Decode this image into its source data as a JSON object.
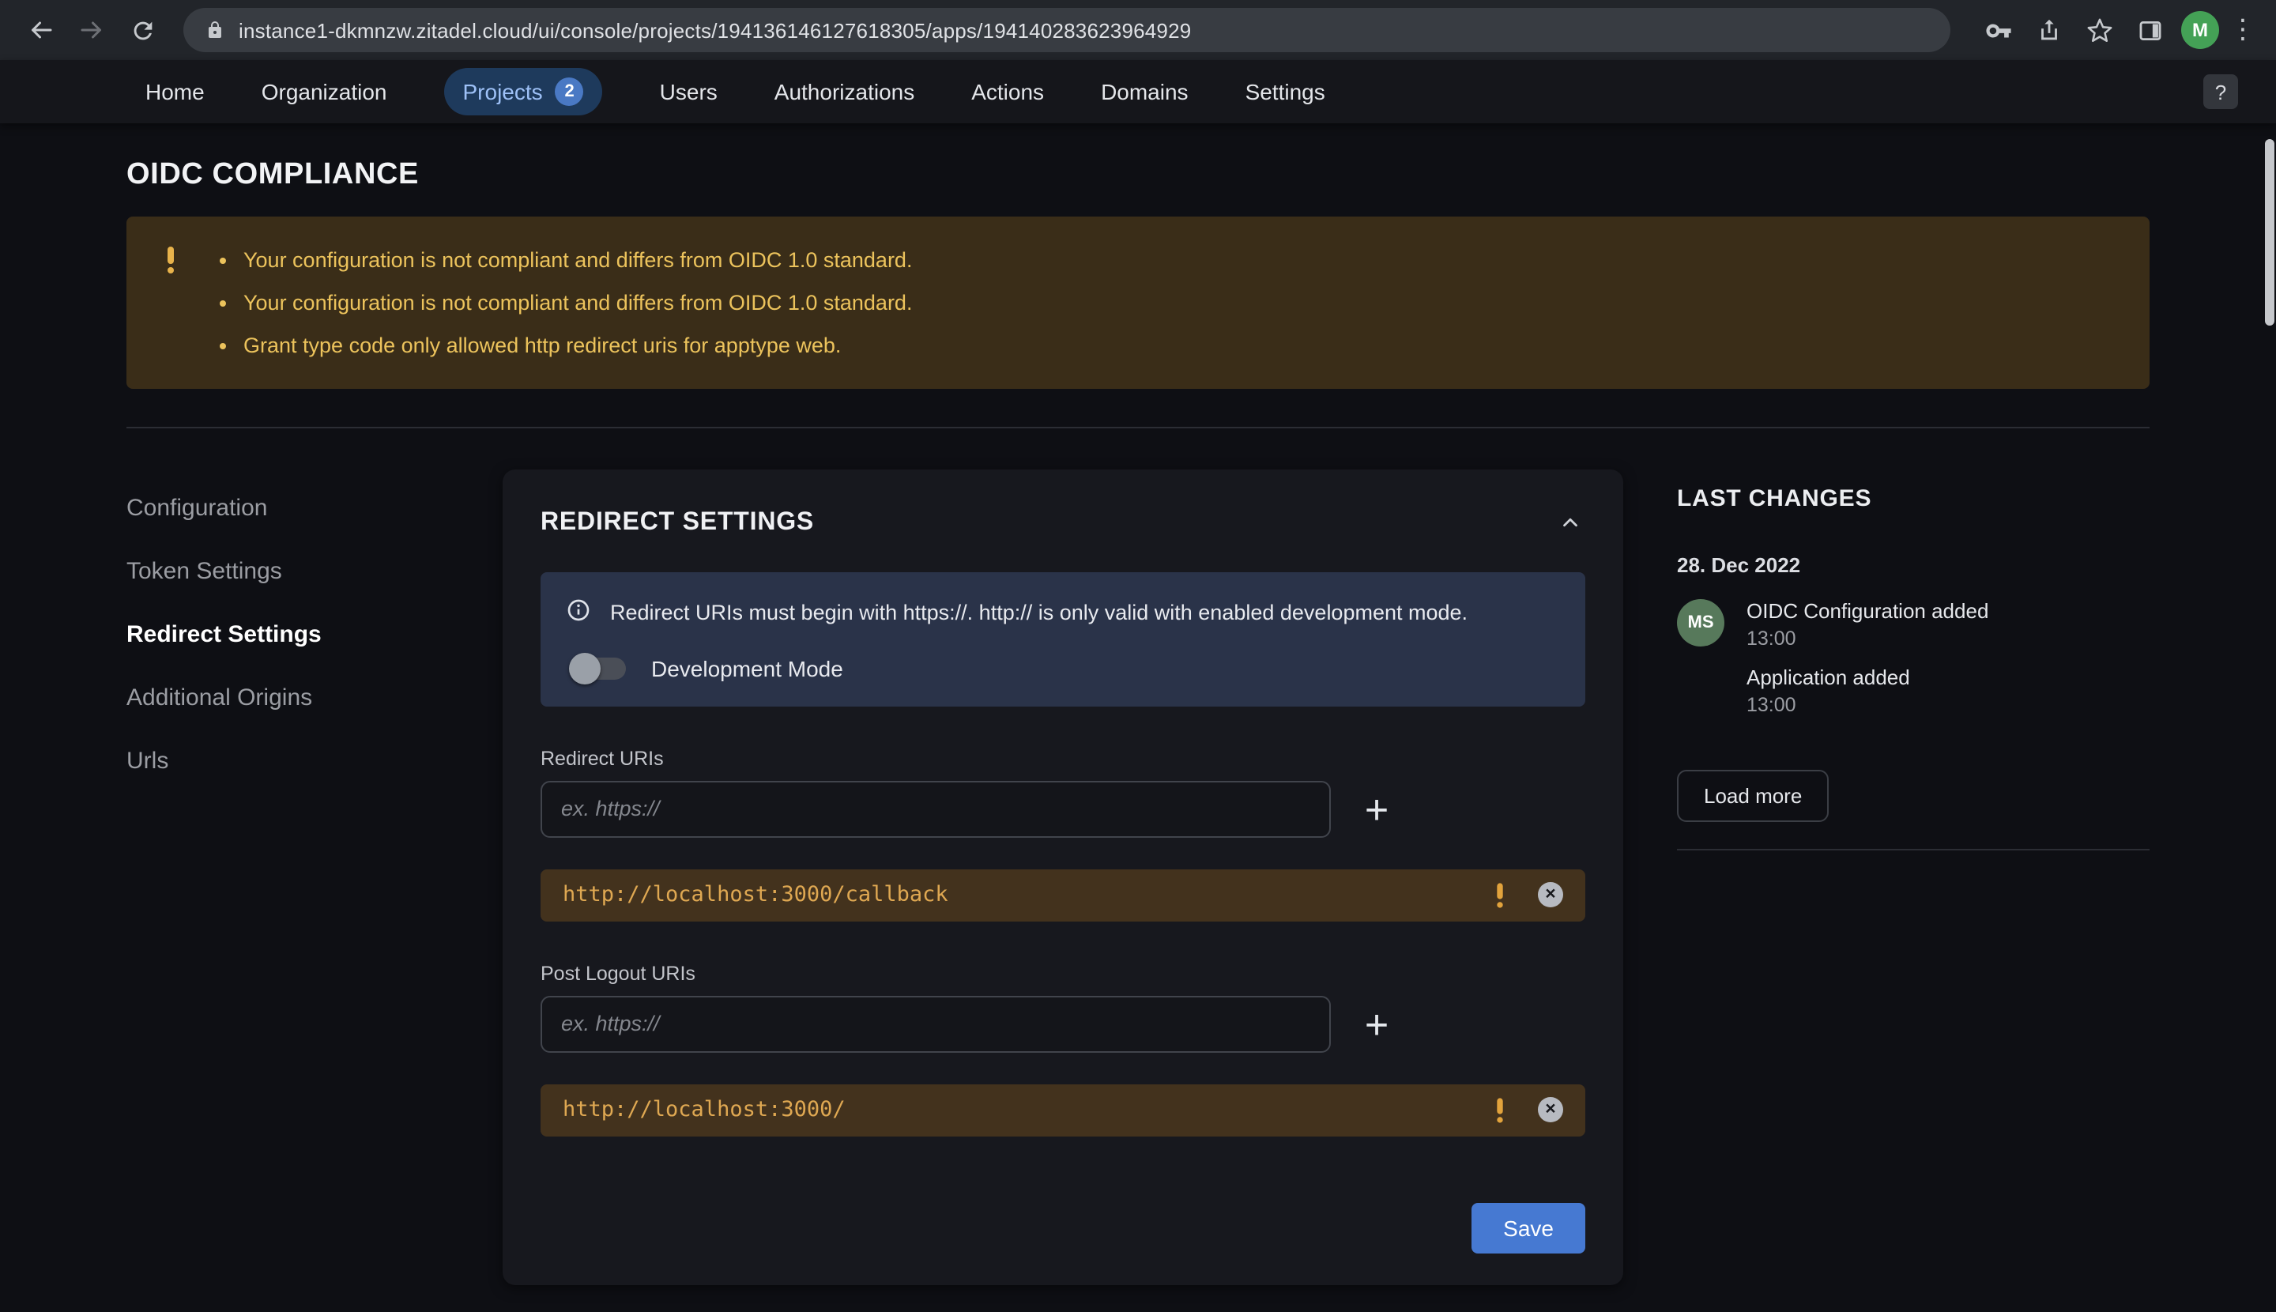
{
  "browser": {
    "url": "instance1-dkmnzw.zitadel.cloud/ui/console/projects/194136146127618305/apps/194140283623964929",
    "avatar_initial": "M"
  },
  "icons": {
    "add": "+",
    "kebab": "⋮",
    "close": "×"
  },
  "nav": {
    "items": [
      {
        "label": "Home"
      },
      {
        "label": "Organization"
      },
      {
        "label": "Projects",
        "badge": "2"
      },
      {
        "label": "Users"
      },
      {
        "label": "Authorizations"
      },
      {
        "label": "Actions"
      },
      {
        "label": "Domains"
      },
      {
        "label": "Settings"
      }
    ],
    "help_label": "?"
  },
  "compliance": {
    "title": "OIDC COMPLIANCE",
    "warnings": [
      "Your configuration is not compliant and differs from OIDC 1.0 standard.",
      "Your configuration is not compliant and differs from OIDC 1.0 standard.",
      "Grant type code only allowed http redirect uris for apptype web."
    ]
  },
  "sidebar": {
    "items": [
      {
        "label": "Configuration"
      },
      {
        "label": "Token Settings"
      },
      {
        "label": "Redirect Settings"
      },
      {
        "label": "Additional Origins"
      },
      {
        "label": "Urls"
      }
    ]
  },
  "redirect_card": {
    "title": "REDIRECT SETTINGS",
    "info_text": "Redirect URIs must begin with https://. http:// is only valid with enabled development mode.",
    "dev_mode_label": "Development Mode",
    "redirect_uris_label": "Redirect URIs",
    "redirect_input_placeholder": "ex. https://",
    "redirect_uris": [
      "http://localhost:3000/callback"
    ],
    "post_logout_label": "Post Logout URIs",
    "post_logout_placeholder": "ex. https://",
    "post_logout_uris": [
      "http://localhost:3000/"
    ],
    "save_label": "Save"
  },
  "last_changes": {
    "title": "LAST CHANGES",
    "date": "28. Dec 2022",
    "avatar_initials": "MS",
    "events": [
      {
        "label": "OIDC Configuration added",
        "time": "13:00"
      },
      {
        "label": "Application added",
        "time": "13:00"
      }
    ],
    "load_more_label": "Load more"
  },
  "colors": {
    "accent_blue": "#4679d2",
    "warning_amber": "#ecc35c",
    "chip_bg": "#43321d",
    "avatar_green": "#57795b"
  }
}
